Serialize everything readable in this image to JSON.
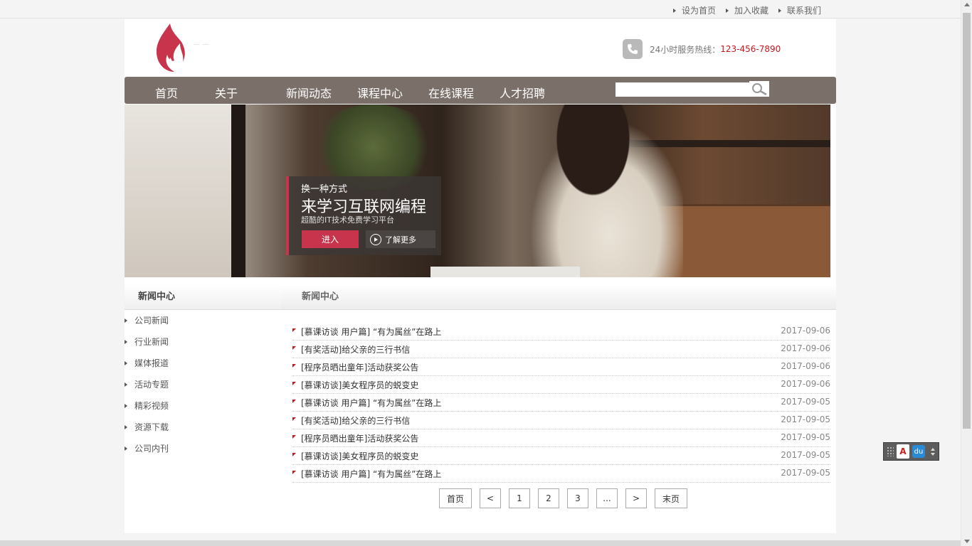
{
  "top_links": [
    {
      "label": "设为首页"
    },
    {
      "label": "加入收藏"
    },
    {
      "label": "联系我们"
    }
  ],
  "header": {
    "hotline_label": "24小时服务热线：",
    "hotline_number": "123-456-7890"
  },
  "nav": {
    "items": [
      {
        "label": "首页"
      },
      {
        "label": "关于"
      },
      {
        "label": "新闻动态"
      },
      {
        "label": "课程中心"
      },
      {
        "label": "在线课程"
      },
      {
        "label": "人才招聘"
      }
    ],
    "search_value": ""
  },
  "banner": {
    "line1": "换一种方式",
    "line2": "来学习互联网编程",
    "line3": "超酷的IT技术免费学习平台",
    "enter_label": "进入",
    "more_label": "了解更多"
  },
  "sidebar": {
    "title": "新闻中心",
    "items": [
      {
        "label": "公司新闻"
      },
      {
        "label": "行业新闻"
      },
      {
        "label": "媒体报道"
      },
      {
        "label": "活动专题"
      },
      {
        "label": "精彩视频"
      },
      {
        "label": "资源下载"
      },
      {
        "label": "公司内刊"
      }
    ]
  },
  "content": {
    "title": "新闻中心",
    "news": [
      {
        "title": "[慕课访谈 用户篇] “有为属丝”在路上",
        "date": "2017-09-06"
      },
      {
        "title": "[有奖活动]给父亲的三行书信",
        "date": "2017-09-06"
      },
      {
        "title": "[程序员晒出童年]活动获奖公告",
        "date": "2017-09-06"
      },
      {
        "title": "[慕课访谈]美女程序员的蜕变史",
        "date": "2017-09-06"
      },
      {
        "title": "[慕课访谈 用户篇] “有为属丝”在路上",
        "date": "2017-09-05"
      },
      {
        "title": "[有奖活动]给父亲的三行书信",
        "date": "2017-09-05"
      },
      {
        "title": "[程序员晒出童年]活动获奖公告",
        "date": "2017-09-05"
      },
      {
        "title": "[慕课访谈]美女程序员的蜕变史",
        "date": "2017-09-05"
      },
      {
        "title": "[慕课访谈 用户篇] “有为属丝”在路上",
        "date": "2017-09-05"
      }
    ],
    "pager": [
      "首页",
      "<",
      "1",
      "2",
      "3",
      "...",
      ">",
      "末页"
    ]
  },
  "widget": {
    "pdf_icon": "A",
    "du_label": "du"
  },
  "colors": {
    "accent_red": "#c8161d",
    "nav_bg": "#7b7069",
    "promo_button": "#c8344b"
  }
}
